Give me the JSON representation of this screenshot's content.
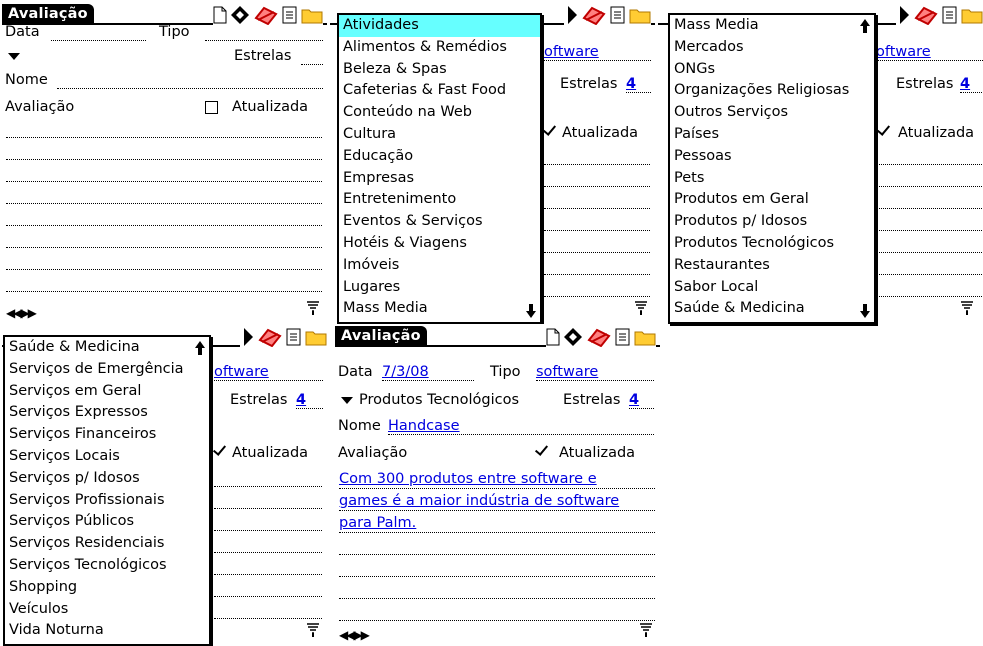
{
  "app": {
    "title": "Avaliação"
  },
  "form_labels": {
    "date": "Data",
    "type": "Tipo",
    "stars": "Estrelas",
    "name": "Nome",
    "review": "Avaliação",
    "updated": "Atualizada"
  },
  "screen_blank": {
    "date": "",
    "type": "",
    "category": "",
    "stars": "",
    "name": "",
    "updated": false
  },
  "screen_filled": {
    "date": "7/3/08",
    "type": "software",
    "category": "Produtos Tecnológicos",
    "stars": "4",
    "name": "Handcase",
    "updated": true,
    "memo_lines": [
      "Com 300 produtos entre software e",
      "games é a maior indústria de software",
      "para Palm."
    ]
  },
  "partial_values": {
    "type_fragment": "oftware",
    "stars": "4"
  },
  "menu1": {
    "selected": "Atividades",
    "items": [
      "Atividades",
      "Alimentos & Remédios",
      "Beleza & Spas",
      "Cafeterias & Fast Food",
      "Conteúdo na Web",
      "Cultura",
      "Educação",
      "Empresas",
      "Entretenimento",
      "Eventos & Serviços",
      "Hotéis & Viagens",
      "Imóveis",
      "Lugares",
      "Mass Media"
    ]
  },
  "menu2": {
    "items": [
      "Mass Media",
      "Mercados",
      "ONGs",
      "Organizações Religiosas",
      "Outros Serviços",
      "Países",
      "Pessoas",
      "Pets",
      "Produtos em Geral",
      "Produtos p/ Idosos",
      "Produtos Tecnológicos",
      "Restaurantes",
      "Sabor Local",
      "Saúde & Medicina"
    ]
  },
  "menu3": {
    "items": [
      "Saúde & Medicina",
      "Serviços de Emergência",
      "Serviços em Geral",
      "Serviços Expressos",
      "Serviços Financeiros",
      "Serviços Locais",
      "Serviços p/ Idosos",
      "Serviços Profissionais",
      "Serviços Públicos",
      "Serviços Residenciais",
      "Serviços Tecnológicos",
      "Shopping",
      "Veículos",
      "Vida Noturna"
    ]
  },
  "icons": [
    "new-document-icon",
    "navigation-diamond-icon",
    "delete-eraser-icon",
    "notes-icon",
    "folder-icon",
    "nav-arrows-icon",
    "signal-icon"
  ],
  "colors": {
    "link_blue": "#0000e0",
    "menu_highlight": "#66ffff",
    "folder_yellow": "#ffcc33",
    "eraser_red": "#e02020"
  }
}
